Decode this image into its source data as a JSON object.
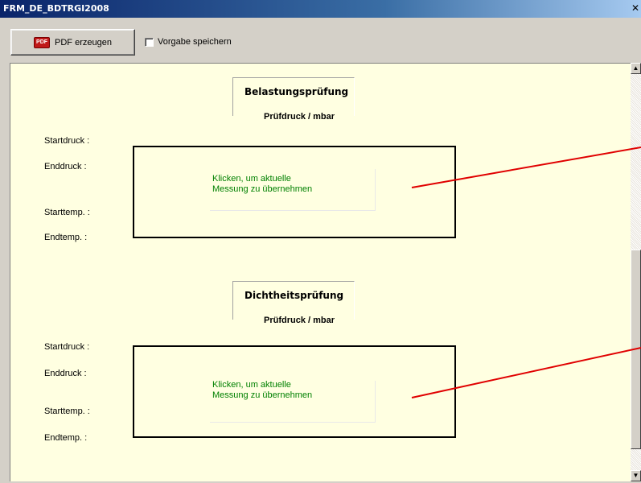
{
  "window": {
    "title": "FRM_DE_BDTRGI2008",
    "close_symbol": "✕"
  },
  "toolbar": {
    "pdf_icon_text": "PDF",
    "pdf_button_label": "PDF erzeugen",
    "checkbox_label": "Vorgabe speichern",
    "checkbox_checked": false
  },
  "sections": [
    {
      "title": "Belastungsprüfung",
      "unit_label": "Prüfdruck / mbar",
      "labels": [
        "Startdruck :",
        "Enddruck :",
        "Starttemp. :",
        "Endtemp. :"
      ],
      "measure_text_line1": "Klicken, um aktuelle",
      "measure_text_line2": "Messung zu übernehmen"
    },
    {
      "title": "Dichtheitsprüfung",
      "unit_label": "Prüfdruck / mbar",
      "labels": [
        "Startdruck :",
        "Enddruck :",
        "Starttemp. :",
        "Endtemp. :"
      ],
      "measure_text_line1": "Klicken, um aktuelle",
      "measure_text_line2": "Messung zu übernehmen"
    }
  ],
  "colors": {
    "content_bg": "#ffffe1",
    "measure_text": "#008000",
    "pointer_line": "#e00000"
  }
}
